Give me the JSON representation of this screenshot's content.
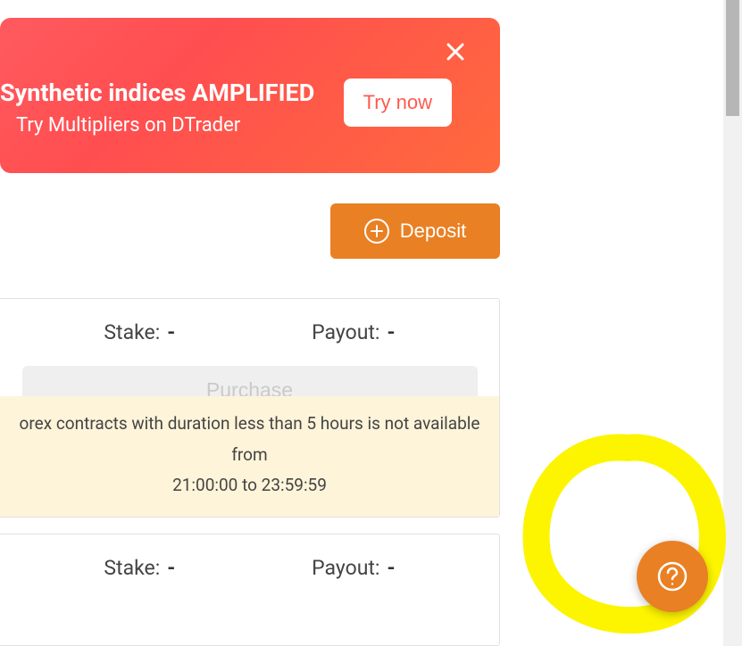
{
  "promo": {
    "title": "Synthetic indices AMPLIFIED",
    "subtitle": "Try Multipliers on DTrader",
    "cta": "Try now"
  },
  "deposit": {
    "label": "Deposit"
  },
  "card1": {
    "stake_label": "Stake:",
    "stake_value": "-",
    "payout_label": "Payout:",
    "payout_value": "-",
    "purchase_label": "Purchase",
    "warning_line1": "orex contracts with duration less than 5 hours is not available from",
    "warning_line2": "21:00:00 to 23:59:59"
  },
  "card2": {
    "stake_label": "Stake:",
    "stake_value": "-",
    "payout_label": "Payout:",
    "payout_value": "-"
  }
}
